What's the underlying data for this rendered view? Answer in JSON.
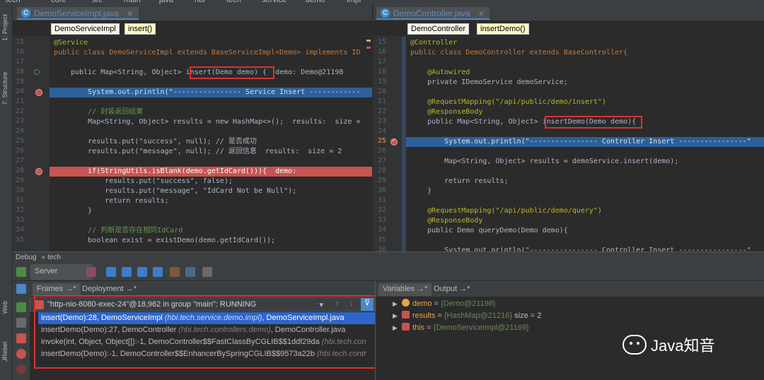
{
  "breadcrumb": [
    "tech",
    "core",
    "src",
    "main",
    "java",
    "hbi",
    "tech",
    "service",
    "demo",
    "impl"
  ],
  "left_tool_strip": {
    "project": "1: Project",
    "structure": "7: Structure",
    "web": "Web",
    "jrebel": "JRebel"
  },
  "editor_left": {
    "tab": "DemoServiceImpl.java",
    "crumbs": [
      "DemoServiceImpl",
      "insert()"
    ],
    "line_numbers": [
      "15",
      "16",
      "17",
      "18",
      "19",
      "20",
      "21",
      "22",
      "23",
      "24",
      "25",
      "26",
      "27",
      "28",
      "29",
      "30",
      "31",
      "32",
      "33",
      "34",
      "35"
    ],
    "lines": [
      "@Service",
      "public class DemoServiceImpl extends BaseServiceImpl<Demo> implements ID",
      "",
      "    public Map<String, Object> insert(Demo demo) {  demo: Demo@21198",
      "",
      "        System.out.println(\"---------------- Service Insert ------------",
      "",
      "        // 封装返回结果",
      "        Map<String, Object> results = new HashMap<>();  results:  size =",
      "",
      "        results.put(\"success\", null); // 是否成功",
      "        results.put(\"message\", null); // 返回信息  results:  size = 2",
      "",
      "        if(StringUtils.isBlank(demo.getIdCard())){  demo:",
      "            results.put(\"success\", false);",
      "            results.put(\"message\", \"IdCard Not be Null\");",
      "            return results;",
      "        }",
      "",
      "        // 判断是否存在相同IdCard",
      "        boolean exist = existDemo(demo.getIdCard());"
    ]
  },
  "editor_right": {
    "tab": "DemoController.java",
    "crumbs": [
      "DemoController",
      "insertDemo()"
    ],
    "line_numbers": [
      "15",
      "16",
      "17",
      "18",
      "19",
      "20",
      "21",
      "22",
      "23",
      "24",
      "25",
      "26",
      "27",
      "28",
      "29",
      "30",
      "31",
      "32",
      "33",
      "34",
      "35",
      "36"
    ],
    "lines": [
      "@Controller",
      "public class DemoController extends BaseController{",
      "",
      "    @Autowired",
      "    private IDemoService demoService;",
      "",
      "    @RequestMapping(\"/api/public/demo/insert\")",
      "    @ResponseBody",
      "    public Map<String, Object> insertDemo(Demo demo){",
      "",
      "        System.out.println(\"---------------- Controller Insert ----------------\"",
      "",
      "        Map<String, Object> results = demoService.insert(demo);",
      "",
      "        return results;",
      "    }",
      "",
      "    @RequestMapping(\"/api/public/demo/query\")",
      "    @ResponseBody",
      "    public Demo queryDemo(Demo demo){",
      "",
      "        System.out.println(\"---------------- Controller Insert ----------------\""
    ]
  },
  "debug": {
    "title": "Debug",
    "config": "tech",
    "server_tab": "Server",
    "frames_tab": "Frames →*",
    "deployment_tab": "Deployment →*",
    "thread": "\"http-nio-8080-exec-24\"@18,962 in group \"main\": RUNNING",
    "frames": [
      {
        "method": "insert(Demo):28, DemoServiceImpl",
        "pkg": "(hbi.tech.service.demo.impl)",
        "file": ", DemoServiceImpl.java"
      },
      {
        "method": "insertDemo(Demo):27, DemoController",
        "pkg": "(hbi.tech.controllers.demo)",
        "file": ", DemoController.java"
      },
      {
        "method": "invoke(int, Object, Object[]):-1, DemoController$$FastClassByCGLIB$$1ddf29da",
        "pkg": "(hbi.tech.con",
        "file": ""
      },
      {
        "method": "insertDemo(Demo):-1, DemoController$$EnhancerBySpringCGLIB$$9573a22b",
        "pkg": "(hbi.tech.contr",
        "file": ""
      }
    ],
    "variables_tab": "Variables →*",
    "output_tab": "Output →*",
    "variables": [
      {
        "name": "demo",
        "value": "{Demo@21198}",
        "extra": ""
      },
      {
        "name": "results",
        "value": "{HashMap@21216}",
        "extra": " size = 2"
      },
      {
        "name": "this",
        "value": "{DemoServiceImpl@21169}",
        "extra": ""
      }
    ]
  },
  "watermark": "Java知音",
  "colors": {
    "accent_blue": "#2d6099",
    "breakpoint_red": "#c75450",
    "annotation_box": "#e03030",
    "selection": "#2f65ca"
  }
}
